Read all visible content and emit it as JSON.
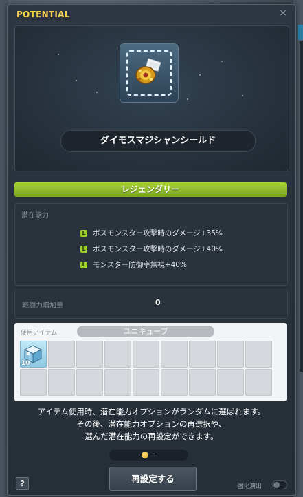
{
  "window": {
    "title": "POTENTIAL",
    "close_glyph": "×"
  },
  "item": {
    "name": "ダイモスマジシャンシールド",
    "icon": "shield-item-icon"
  },
  "grade": {
    "label": "レジェンダリー",
    "color": "#97c42c"
  },
  "potential": {
    "label": "潜在能力",
    "badge": "L",
    "lines": [
      "ボスモンスター攻撃時のダメージ+35%",
      "ボスモンスター攻撃時のダメージ+40%",
      "モンスター防御率無視+40%"
    ]
  },
  "combat_power": {
    "label": "戦闘力増加量",
    "value": "0"
  },
  "use_item": {
    "label": "使用アイテム",
    "cube_name": "ユニキューブ",
    "cube_quantity": "10",
    "slot_count": 18
  },
  "description": [
    "アイテム使用時、潜在能力オプションがランダムに選ばれます。",
    "その後、潜在能力オプションの再選択や、",
    "選んだ潜在能力の再設定ができます。"
  ],
  "cost": {
    "value": "–"
  },
  "buttons": {
    "reset": "再設定する",
    "help": "?"
  },
  "effect_toggle": {
    "label": "強化演出",
    "on": false
  }
}
